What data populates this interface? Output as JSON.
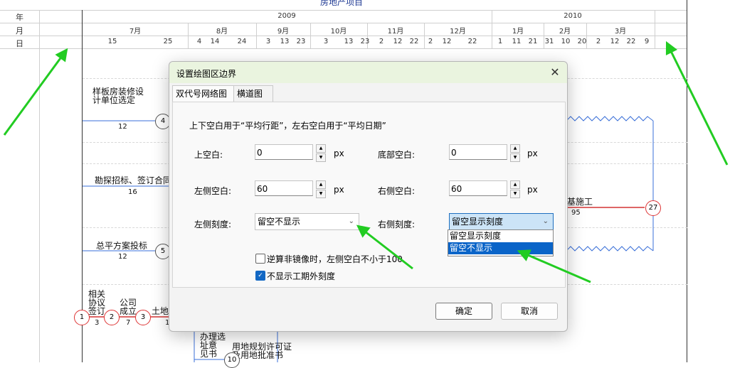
{
  "chart": {
    "title": "房地产项目",
    "row_labels": {
      "year": "年",
      "month": "月",
      "day": "日"
    },
    "years": [
      "2009",
      "2010"
    ],
    "months": [
      "7月",
      "8月",
      "9月",
      "10月",
      "11月",
      "12月",
      "1月",
      "2月",
      "3月"
    ],
    "days": [
      "15",
      "25",
      "4",
      "14",
      "24",
      "3",
      "13",
      "23",
      "3",
      "13",
      "23",
      "2",
      "12",
      "22",
      "2",
      "12",
      "22",
      "1",
      "11",
      "21",
      "31",
      "10",
      "20",
      "2",
      "12",
      "22",
      "9"
    ],
    "tasks": [
      {
        "label": "样板房装修设\n计单位选定",
        "duration": "12",
        "node": "4"
      },
      {
        "label": "勘探招标、签订合同",
        "duration": "16",
        "node": ""
      },
      {
        "label": "总平方案投标",
        "duration": "12",
        "node": "5"
      },
      {
        "label": "基施工",
        "duration": "95",
        "node": "27"
      },
      {
        "label": "相关\n协议\n签订",
        "duration": "3",
        "node": "1"
      },
      {
        "label": "公司\n成立",
        "duration": "7",
        "node": "2"
      },
      {
        "label": "土地",
        "duration": "1",
        "node": "3"
      },
      {
        "label": "办理选\n址意\n见书",
        "duration": "",
        "node": "10"
      },
      {
        "label": "用地规划许可证\n及用地批准书",
        "duration": "",
        "node": ""
      }
    ]
  },
  "dialog": {
    "title": "设置绘图区边界",
    "close_icon": "close-icon",
    "tabs": [
      {
        "label": "双代号网络图"
      },
      {
        "label": "横道图"
      }
    ],
    "description": "上下空白用于“平均行距”，左右空白用于“平均日期”",
    "fields": {
      "top": {
        "label": "上空白:",
        "value": "0",
        "unit": "px"
      },
      "bottom": {
        "label": "底部空白:",
        "value": "0",
        "unit": "px"
      },
      "left": {
        "label": "左侧空白:",
        "value": "60",
        "unit": "px"
      },
      "right": {
        "label": "右侧空白:",
        "value": "60",
        "unit": "px"
      }
    },
    "left_scale": {
      "label": "左侧刻度:",
      "value": "留空不显示"
    },
    "right_scale": {
      "label": "右侧刻度:",
      "value": "留空显示刻度",
      "options": [
        "留空显示刻度",
        "留空不显示"
      ]
    },
    "checkbox1": {
      "label": "逆算非镜像时，左侧空白不小于100",
      "checked": false
    },
    "checkbox2": {
      "label": "不显示工期外刻度",
      "checked": true
    },
    "ok": "确定",
    "cancel": "取消"
  },
  "colors": {
    "arrow": "#22cc22",
    "accent": "#0a64c8",
    "red_line": "#d33333",
    "blue_line": "#3a6fd8"
  }
}
